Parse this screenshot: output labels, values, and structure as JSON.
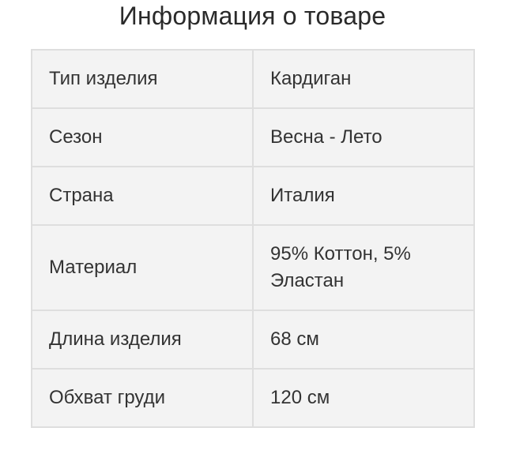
{
  "page": {
    "title": "Информация о товаре"
  },
  "table": {
    "rows": [
      {
        "label": "Тип изделия",
        "value": "Кардиган"
      },
      {
        "label": "Сезон",
        "value": "Весна - Лето"
      },
      {
        "label": "Страна",
        "value": "Италия"
      },
      {
        "label": "Материал",
        "value": "95% Коттон, 5% Эластан"
      },
      {
        "label": "Длина изделия",
        "value": "68 см"
      },
      {
        "label": "Обхват груди",
        "value": "120 см"
      }
    ]
  },
  "colors": {
    "background": "#ffffff",
    "table_fill": "#f3f3f3",
    "table_border": "#dedede",
    "text": "#333333"
  }
}
